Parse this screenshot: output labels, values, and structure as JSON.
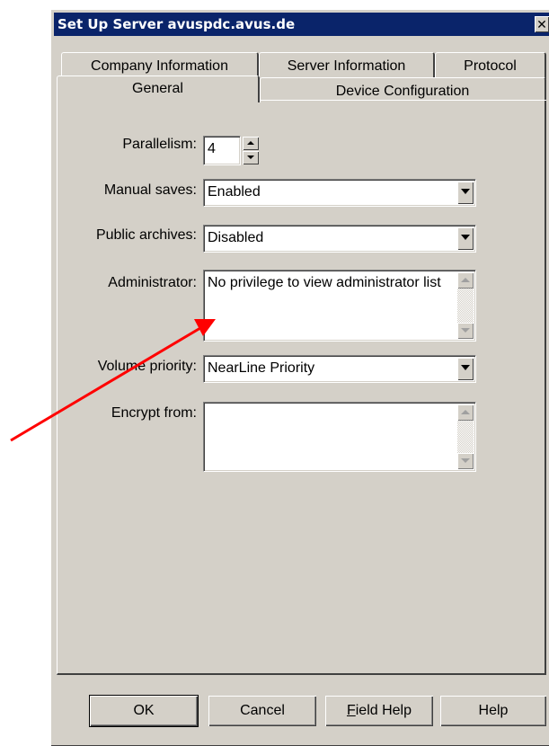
{
  "window": {
    "title": "Set Up Server avuspdc.avus.de",
    "close_glyph": "✕"
  },
  "tabs": {
    "back_row": [
      "Company Information",
      "Server Information",
      "Protocol"
    ],
    "front_row": [
      "General",
      "Device Configuration"
    ],
    "selected": "General"
  },
  "form": {
    "parallelism": {
      "label": "Parallelism:",
      "value": "4"
    },
    "manual_saves": {
      "label": "Manual saves:",
      "value": "Enabled"
    },
    "public_archives": {
      "label": "Public archives:",
      "value": "Disabled"
    },
    "administrator": {
      "label": "Administrator:",
      "value": "No privilege to view administrator list"
    },
    "volume_priority": {
      "label": "Volume priority:",
      "value": "NearLine Priority"
    },
    "encrypt_from": {
      "label": "Encrypt from:",
      "value": ""
    }
  },
  "buttons": {
    "ok": "OK",
    "cancel": "Cancel",
    "field_help_underlined": "F",
    "field_help_rest": "ield Help",
    "help": "Help"
  },
  "annotation": {
    "arrow_color": "#ff0000"
  }
}
